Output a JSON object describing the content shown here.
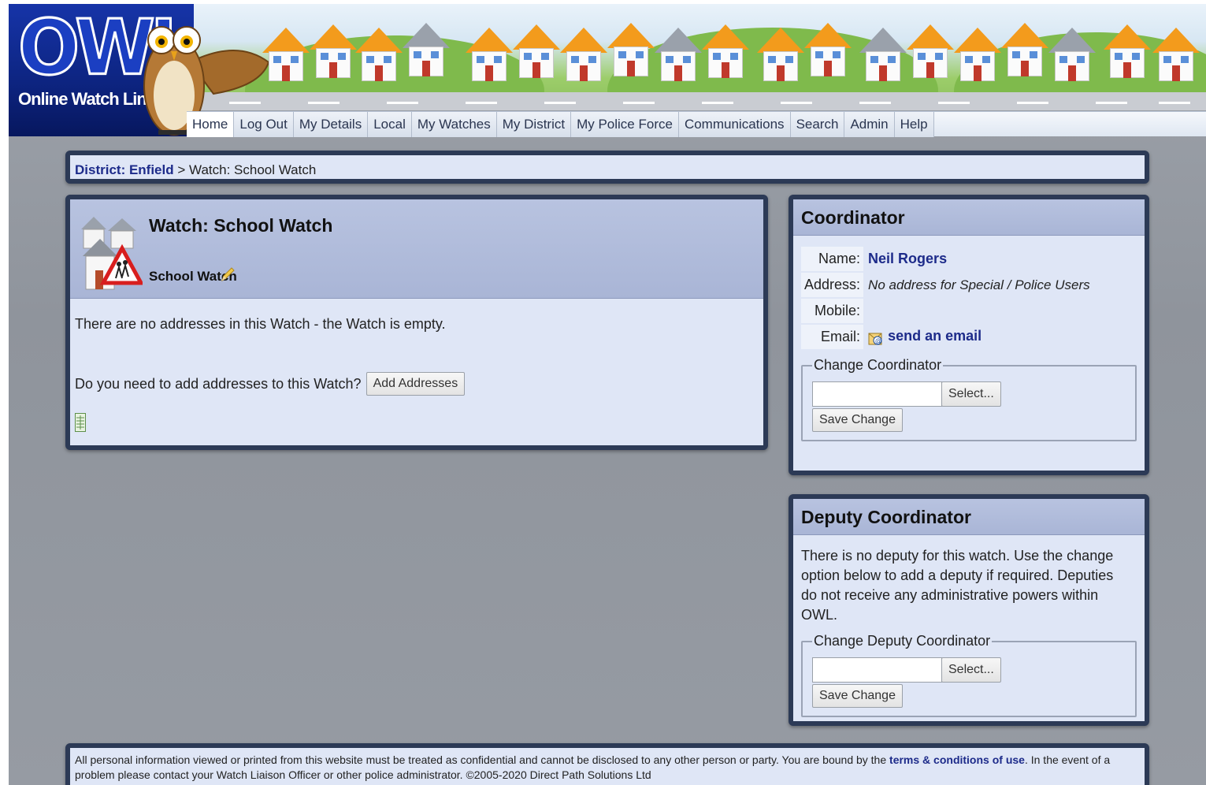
{
  "logo": {
    "title": "OWL",
    "subtitle": "Online Watch Link"
  },
  "nav": {
    "items": [
      "Home",
      "Log Out",
      "My Details",
      "Local",
      "My Watches",
      "My District",
      "My Police Force",
      "Communications",
      "Search",
      "Admin",
      "Help"
    ]
  },
  "breadcrumb": {
    "district_link": "District: Enfield",
    "separator": ">",
    "current": "Watch: School Watch"
  },
  "watch": {
    "title": "Watch: School Watch",
    "subtitle": "School Watch",
    "empty_message": "There are no addresses in this Watch - the Watch is empty.",
    "add_prompt": "Do you need to add addresses to this Watch?",
    "add_button": "Add Addresses"
  },
  "coordinator": {
    "heading": "Coordinator",
    "name_label": "Name:",
    "name": "Neil Rogers",
    "address_label": "Address:",
    "address": "No address for Special / Police Users",
    "mobile_label": "Mobile:",
    "mobile": "",
    "email_label": "Email:",
    "email_link": "send an email",
    "change_legend": "Change Coordinator",
    "select_button": "Select...",
    "save_button": "Save Change"
  },
  "deputy": {
    "heading": "Deputy Coordinator",
    "message": "There is no deputy for this watch. Use the change option below to add a deputy if required. Deputies do not receive any administrative powers within OWL.",
    "change_legend": "Change Deputy Coordinator",
    "select_button": "Select...",
    "save_button": "Save Change"
  },
  "footer": {
    "text_before": "All personal information viewed or printed from this website must be treated as confidential and cannot be disclosed to any other person or party. You are bound by the",
    "terms_link": "terms & conditions of use",
    "text_after": ". In the event of a problem please contact your Watch Liaison Officer or other police administrator. ©2005-2020 Direct Path Solutions Ltd"
  },
  "colors": {
    "nav_text": "#2a3550",
    "link": "#1d2b8a",
    "panel_border": "#2c3a56",
    "panel_bg": "#dfe6f6",
    "panel_head": "#aab6d6",
    "logo_bg": "#0d2480",
    "house_roof": "#f39b1c"
  },
  "icons": {
    "owl_mascot": "owl-mascot-icon",
    "watch": "houses-school-sign-icon",
    "pencil": "pencil-icon",
    "spreadsheet": "spreadsheet-icon",
    "email": "email-envelope-icon"
  }
}
